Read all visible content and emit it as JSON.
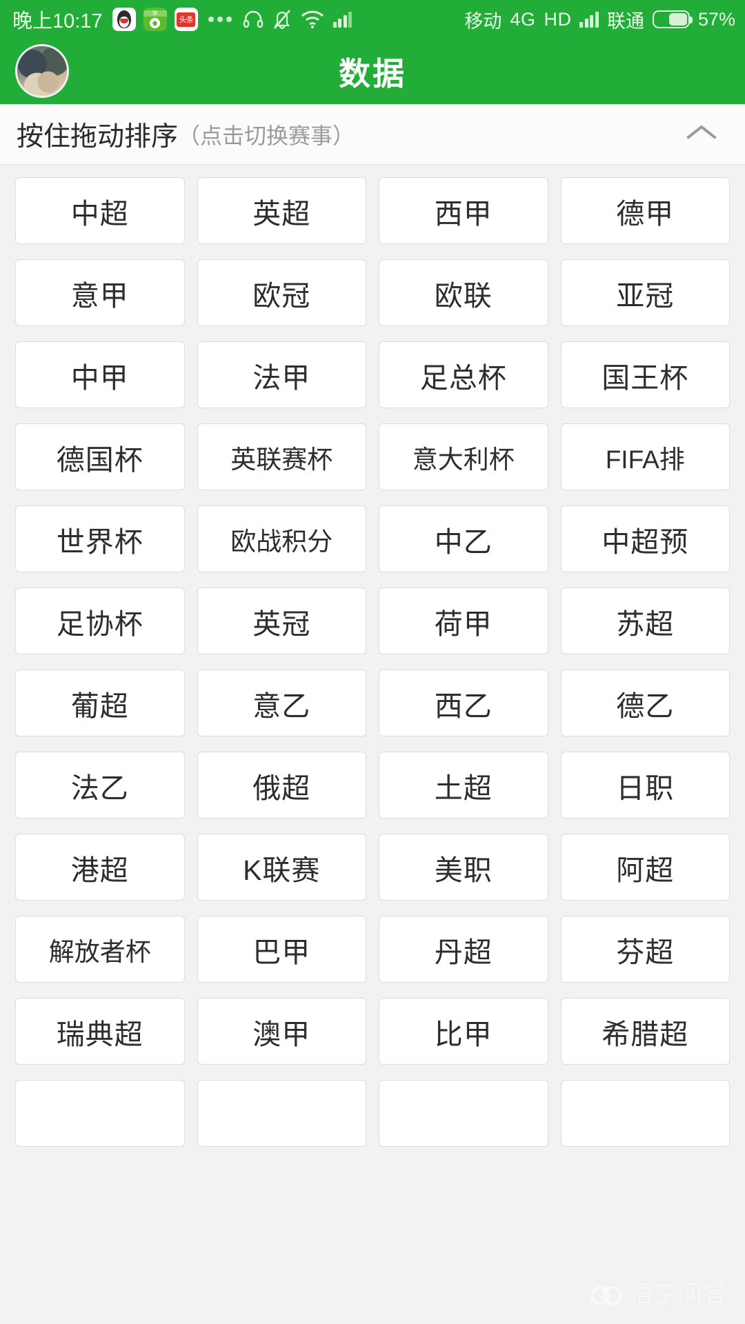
{
  "statusbar": {
    "time": "晚上10:17",
    "app_icons": [
      "qq-icon",
      "football-app-icon",
      "toutiao-icon"
    ],
    "toutiao_label": "头条",
    "football_label": "球",
    "overflow_icon": "more-dots-icon",
    "headset_icon": "headset-icon",
    "mute_icon": "bell-muted-icon",
    "wifi_icon": "wifi-icon",
    "signal_icon_1": "signal-bars-icon",
    "carrier_1": "移动",
    "network_type": "4G",
    "volte": "HD",
    "signal_icon_2": "signal-bars-icon",
    "carrier_2": "联通",
    "battery_icon": "battery-icon",
    "battery_percent": "57%",
    "battery_level": 57,
    "bar_color": "#21ad38",
    "text_color": "#eafbe9"
  },
  "header": {
    "title": "数据",
    "avatar_icon": "user-avatar",
    "bg_color": "#22ad38"
  },
  "sortbar": {
    "main_text": "按住拖动排序",
    "sub_text": "（点击切换赛事）",
    "collapse_icon": "chevron-up-icon"
  },
  "grid": {
    "columns": 4,
    "items": [
      "中超",
      "英超",
      "西甲",
      "德甲",
      "意甲",
      "欧冠",
      "欧联",
      "亚冠",
      "中甲",
      "法甲",
      "足总杯",
      "国王杯",
      "德国杯",
      "英联赛杯",
      "意大利杯",
      "FIFA排",
      "世界杯",
      "欧战积分",
      "中乙",
      "中超预",
      "足协杯",
      "英冠",
      "荷甲",
      "苏超",
      "葡超",
      "意乙",
      "西乙",
      "德乙",
      "法乙",
      "俄超",
      "土超",
      "日职",
      "港超",
      "K联赛",
      "美职",
      "阿超",
      "解放者杯",
      "巴甲",
      "丹超",
      "芬超",
      "瑞典超",
      "澳甲",
      "比甲",
      "希腊超",
      "",
      "",
      "",
      ""
    ]
  },
  "watermark": {
    "text": "悟空问答",
    "logo_icon": "wukong-logo-icon"
  }
}
